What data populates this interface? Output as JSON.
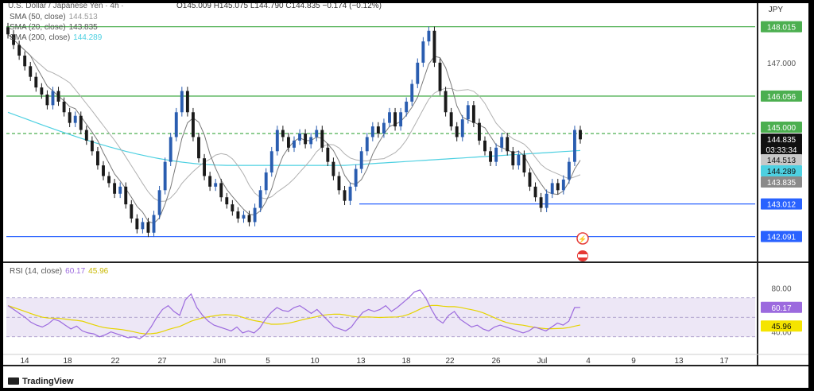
{
  "header": {
    "symbol_text": "U.S. Dollar / Japanese Yen · 4h ·",
    "ohlc_text": "O145.009 H145.075 L144.790 C144.835 −0.174 (−0.12%)",
    "currency": "JPY"
  },
  "indicators": {
    "sma50": {
      "label": "SMA (50, close)",
      "value": "144.513"
    },
    "sma20": {
      "label": "SMA (20, close)",
      "value": "143.835"
    },
    "sma200": {
      "label": "SMA (200, close)",
      "value": "144.289"
    },
    "rsi": {
      "label": "RSI (14, close)",
      "value": "60.17",
      "ma_value": "45.96"
    }
  },
  "price_axis": {
    "ticks": [
      "147.000"
    ],
    "labels": {
      "level_1": "148.015",
      "level_2": "146.056",
      "level_3": "145.000",
      "last_price": "144.835",
      "countdown": "03:33:34",
      "sma50": "144.513",
      "sma200": "144.289",
      "sma20": "143.835",
      "level_4": "143.012",
      "level_5": "142.091"
    }
  },
  "rsi_axis": {
    "ticks": [
      "80.00",
      "40.00"
    ],
    "labels": {
      "rsi": "60.17",
      "rsi_ma": "45.96"
    }
  },
  "time_axis": [
    "14",
    "18",
    "22",
    "27",
    "Jun",
    "5",
    "10",
    "13",
    "18",
    "22",
    "26",
    "Jul",
    "4",
    "9",
    "13",
    "17"
  ],
  "footer": {
    "brand": "TradingView"
  },
  "colors": {
    "up": "#089981",
    "down": "#1a1a1a",
    "candle_up": "#2a5db0",
    "resistance": "#4caf50",
    "support": "#2962ff",
    "sma200": "#4dd0e1",
    "sma50": "#b0b0b0",
    "sma20": "#7a7a7a",
    "rsi": "#9c6ade",
    "rsi_ma": "#e6d400",
    "rsi_band": "#ede7f6"
  },
  "chart_data": {
    "type": "line",
    "title": "U.S. Dollar / Japanese Yen · 4h",
    "x_labels": [
      "14",
      "18",
      "22",
      "27",
      "Jun",
      "5",
      "10",
      "13",
      "18",
      "22",
      "26",
      "Jul",
      "4",
      "9",
      "13",
      "17"
    ],
    "price_levels": [
      148.015,
      146.056,
      145.0,
      143.012,
      142.091
    ],
    "last_price": 144.835,
    "ylim": [
      141.5,
      148.5
    ],
    "series": [
      {
        "name": "SMA (50, close)",
        "last": 144.513
      },
      {
        "name": "SMA (20, close)",
        "last": 143.835
      },
      {
        "name": "SMA (200, close)",
        "last": 144.289
      }
    ],
    "price_path": [
      147.8,
      147.5,
      147.2,
      146.9,
      146.6,
      146.3,
      146.1,
      145.8,
      146.2,
      145.9,
      145.6,
      145.3,
      145.5,
      145.1,
      144.8,
      144.5,
      144.1,
      143.8,
      143.6,
      143.3,
      143.5,
      143.0,
      142.6,
      142.3,
      142.5,
      142.2,
      142.7,
      143.4,
      144.2,
      144.9,
      145.6,
      146.2,
      145.6,
      144.9,
      144.3,
      143.8,
      143.5,
      143.6,
      143.2,
      143.0,
      142.8,
      142.6,
      142.7,
      142.5,
      142.9,
      143.4,
      143.9,
      144.5,
      145.1,
      144.9,
      144.6,
      144.8,
      145.0,
      144.7,
      144.9,
      145.1,
      144.6,
      144.2,
      143.8,
      143.4,
      143.1,
      143.5,
      144.0,
      144.5,
      144.9,
      145.2,
      145.0,
      145.3,
      145.6,
      145.2,
      145.6,
      145.9,
      146.4,
      147.0,
      147.6,
      147.9,
      147.0,
      146.2,
      145.6,
      145.2,
      144.9,
      145.4,
      145.8,
      145.3,
      144.8,
      144.5,
      144.2,
      144.6,
      144.9,
      144.5,
      144.1,
      144.4,
      143.9,
      143.5,
      143.2,
      142.9,
      143.3,
      143.6,
      143.4,
      143.7,
      144.2,
      145.1,
      144.835
    ],
    "rsi": {
      "label": "RSI (14, close)",
      "ylim": [
        20,
        100
      ],
      "band": [
        30,
        70
      ],
      "reference_ticks": [
        80,
        40
      ],
      "last": 60.17,
      "ma_last": 45.96,
      "values": [
        62,
        58,
        54,
        50,
        45,
        42,
        40,
        43,
        48,
        46,
        42,
        38,
        41,
        36,
        34,
        33,
        30,
        32,
        35,
        33,
        31,
        29,
        30,
        28,
        32,
        40,
        50,
        58,
        62,
        56,
        52,
        68,
        74,
        60,
        52,
        46,
        42,
        40,
        38,
        36,
        40,
        34,
        36,
        34,
        39,
        48,
        55,
        60,
        57,
        56,
        60,
        62,
        58,
        54,
        58,
        52,
        46,
        40,
        38,
        36,
        40,
        48,
        55,
        58,
        56,
        58,
        62,
        56,
        60,
        65,
        70,
        76,
        78,
        70,
        58,
        48,
        44,
        52,
        56,
        48,
        44,
        40,
        42,
        38,
        36,
        40,
        42,
        40,
        38,
        36,
        34,
        36,
        40,
        38,
        36,
        40,
        44,
        42,
        46,
        60,
        60.17
      ]
    }
  }
}
